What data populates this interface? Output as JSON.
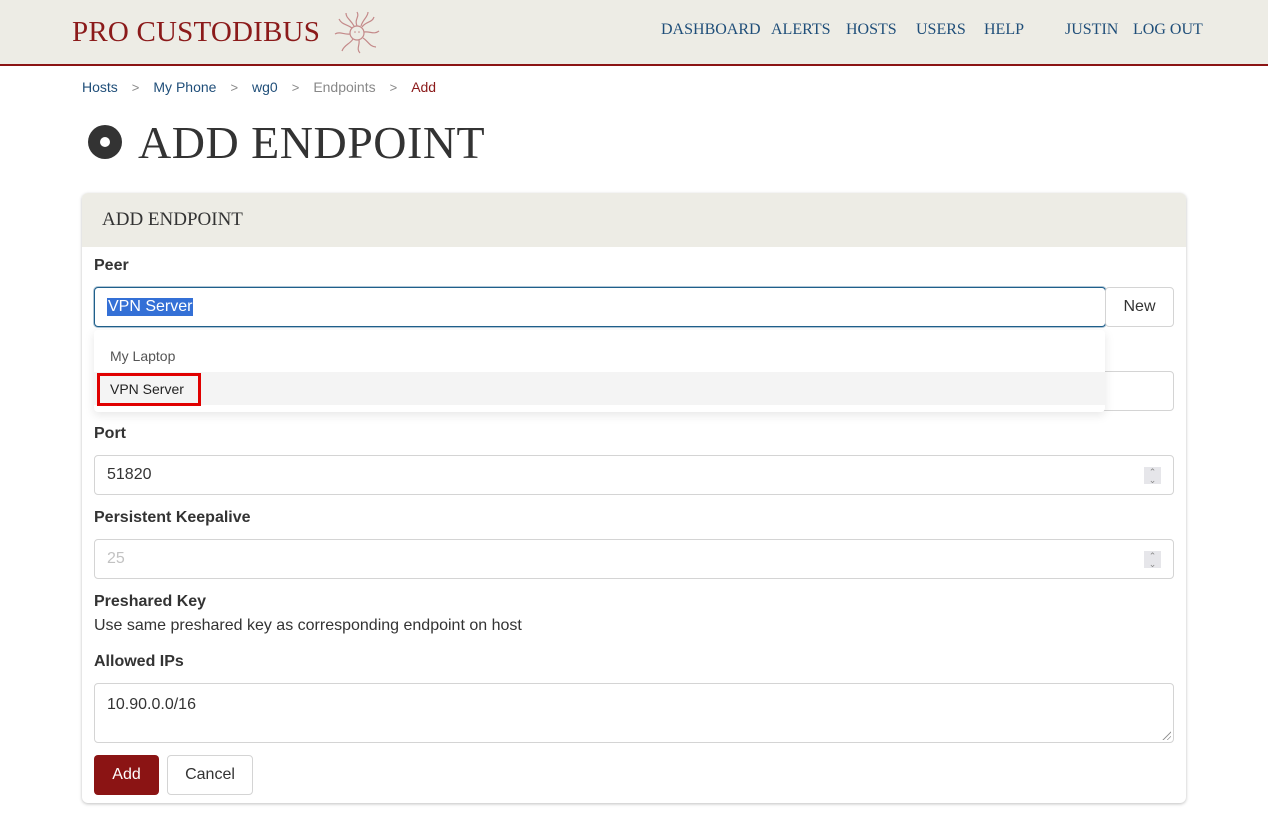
{
  "header": {
    "brand": "PRO CUSTODIBUS",
    "nav": [
      {
        "label": "DASHBOARD"
      },
      {
        "label": "ALERTS"
      },
      {
        "label": "HOSTS"
      },
      {
        "label": "USERS"
      },
      {
        "label": "HELP"
      }
    ],
    "user": "JUSTIN",
    "logout": "LOG OUT"
  },
  "breadcrumb": [
    {
      "label": "Hosts"
    },
    {
      "label": "My Phone"
    },
    {
      "label": "wg0"
    },
    {
      "label": "Endpoints"
    },
    {
      "label": "Add"
    }
  ],
  "breadcrumb_separator": ">",
  "page": {
    "title": "ADD ENDPOINT"
  },
  "form": {
    "card_title": "ADD ENDPOINT",
    "peer": {
      "label": "Peer",
      "value": "VPN Server",
      "new_button": "New",
      "options": [
        {
          "label": "My Laptop"
        },
        {
          "label": "VPN Server",
          "highlighted": true
        }
      ]
    },
    "port": {
      "label": "Port",
      "value": "51820"
    },
    "keepalive": {
      "label": "Persistent Keepalive",
      "placeholder": "25"
    },
    "preshared_key": {
      "label": "Preshared Key",
      "help": "Use same preshared key as corresponding endpoint on host"
    },
    "allowed_ips": {
      "label": "Allowed IPs",
      "value": "10.90.0.0/16"
    },
    "add_button": "Add",
    "cancel_button": "Cancel"
  },
  "colors": {
    "brand": "#8b1a1a",
    "nav_link": "#1f4e79",
    "header_bg": "#edece5",
    "primary_button": "#8b1414",
    "annotation_box": "#e00000"
  }
}
